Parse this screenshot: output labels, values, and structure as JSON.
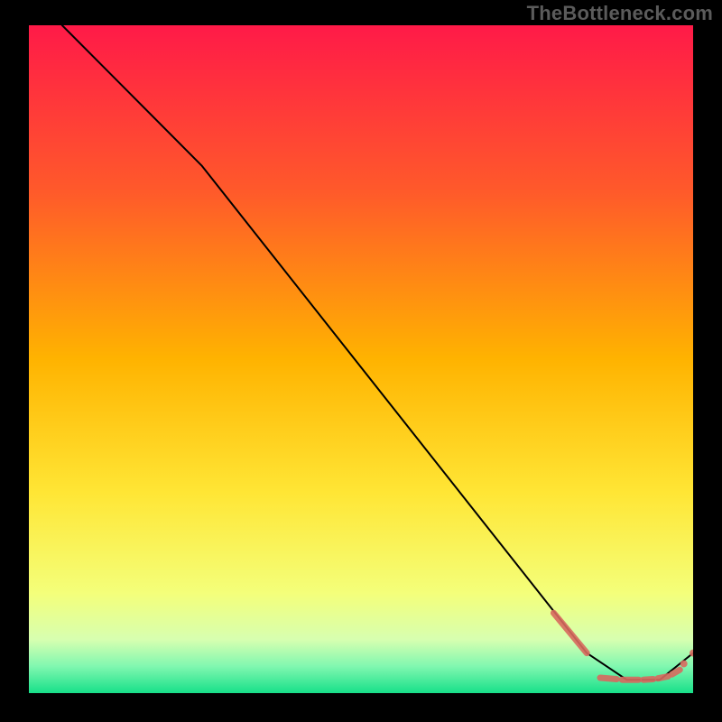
{
  "watermark": "TheBottleneck.com",
  "chart_data": {
    "type": "line",
    "title": "",
    "xlabel": "",
    "ylabel": "",
    "xlim": [
      0,
      100
    ],
    "ylim": [
      0,
      100
    ],
    "gradient_stops": [
      {
        "offset": 0,
        "color": "#ff1a48"
      },
      {
        "offset": 25,
        "color": "#ff5a2a"
      },
      {
        "offset": 50,
        "color": "#ffb300"
      },
      {
        "offset": 70,
        "color": "#ffe635"
      },
      {
        "offset": 85,
        "color": "#f4ff7a"
      },
      {
        "offset": 92,
        "color": "#d7ffb0"
      },
      {
        "offset": 96,
        "color": "#80f7b0"
      },
      {
        "offset": 100,
        "color": "#17e089"
      }
    ],
    "series": [
      {
        "name": "curve",
        "stroke": "#000000",
        "points": [
          {
            "x": 5,
            "y": 100
          },
          {
            "x": 26,
            "y": 79
          },
          {
            "x": 84,
            "y": 6
          },
          {
            "x": 90,
            "y": 2
          },
          {
            "x": 95,
            "y": 2
          },
          {
            "x": 100,
            "y": 6
          }
        ]
      }
    ],
    "marker_band": {
      "color": "#d86a5f",
      "opacity": 0.9,
      "dashes": [
        {
          "x1": 79,
          "y1": 12,
          "x2": 84,
          "y2": 6
        },
        {
          "x1": 86,
          "y1": 2.3,
          "x2": 88.5,
          "y2": 2.1
        },
        {
          "x1": 89.3,
          "y1": 2.0,
          "x2": 91.8,
          "y2": 2.0
        },
        {
          "x1": 92.5,
          "y1": 2.0,
          "x2": 94.0,
          "y2": 2.1
        },
        {
          "x1": 94.7,
          "y1": 2.2,
          "x2": 96.2,
          "y2": 2.5
        },
        {
          "x1": 96.8,
          "y1": 2.8,
          "x2": 98.0,
          "y2": 3.5
        }
      ],
      "dots": [
        {
          "x": 98.6,
          "y": 4.4
        },
        {
          "x": 100,
          "y": 6.0
        }
      ]
    }
  }
}
